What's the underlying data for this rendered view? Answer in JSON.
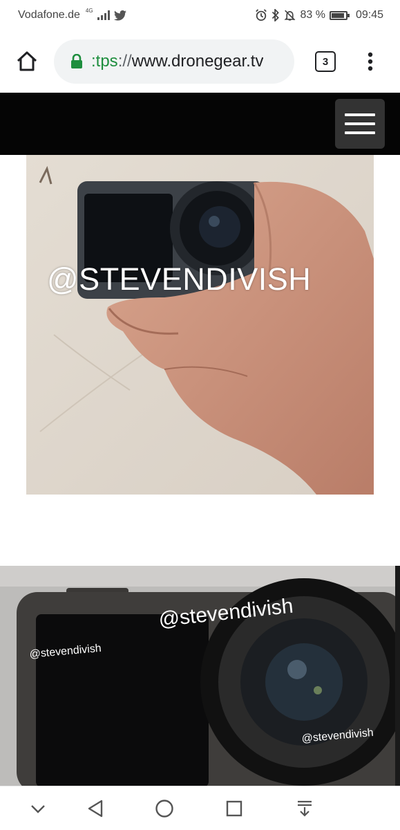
{
  "status_bar": {
    "carrier": "Vodafone.de",
    "network": "4G",
    "battery_text": "83 %",
    "battery_level": 0.83,
    "time": "09:45",
    "icons": [
      "signal-icon",
      "twitter-icon",
      "alarm-icon",
      "bluetooth-icon",
      "mute-icon",
      "battery-icon"
    ]
  },
  "toolbar": {
    "url_scheme": ":tps",
    "url_separator": "://",
    "url_host": "www.dronegear.tv",
    "tab_count": "3",
    "icons": [
      "home-icon",
      "lock-icon",
      "overflow-menu-icon"
    ]
  },
  "site_header": {
    "menu_icon": "hamburger-menu-icon"
  },
  "content": {
    "photo1_watermark": "@STEVENDIVISH",
    "photo2_watermark_main": "@stevendivish",
    "photo2_watermark_left": "@stevendivish",
    "photo2_watermark_right": "@stevendivish"
  },
  "navbar": {
    "icons": [
      "chevron-down-icon",
      "back-icon",
      "home-circle-icon",
      "recents-icon",
      "download-icon"
    ]
  },
  "colors": {
    "secure_green": "#1e8e3e",
    "header_black": "#050505"
  }
}
